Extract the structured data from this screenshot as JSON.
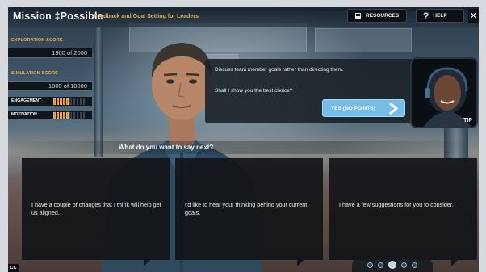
{
  "app": {
    "brand": "Mission ‡Possible",
    "subtitle": "Feedback and Goal Setting for Leaders"
  },
  "toolbar": {
    "resources_label": "RESOURCES",
    "help_label": "HELP",
    "close_label": "✕"
  },
  "scores": {
    "exploration": {
      "label": "EXPLORATION SCORE",
      "value": "1900 of 2000"
    },
    "simulation": {
      "label": "SIMULATION SCORE",
      "value": "1000 of 10000"
    },
    "engagement": {
      "label": "ENGAGEMENT",
      "level": 5,
      "max": 10
    },
    "motivation": {
      "label": "MOTIVATION",
      "level": 5,
      "max": 10
    }
  },
  "prompt": {
    "text": "Discuss team member goals rather than directing them.",
    "question": "Shall I show you the best choice?",
    "yes_label": "YES (NO POINTS)"
  },
  "coach": {
    "tip_label": "TIP"
  },
  "question": "What do you want to say next?",
  "choices": [
    {
      "text": "I have a couple of changes that I think will help get us aligned."
    },
    {
      "text": "I'd like to hear your thinking behind your current goals."
    },
    {
      "text": "I have a few suggestions for you to consider."
    }
  ],
  "pager": {
    "count": 5,
    "active": 2
  },
  "cc_label": "CC",
  "colors": {
    "score_label": "#e7b451",
    "meter_on": "#e48a2a",
    "yes_button": "#74bde6",
    "panel_dark": "#121418"
  }
}
